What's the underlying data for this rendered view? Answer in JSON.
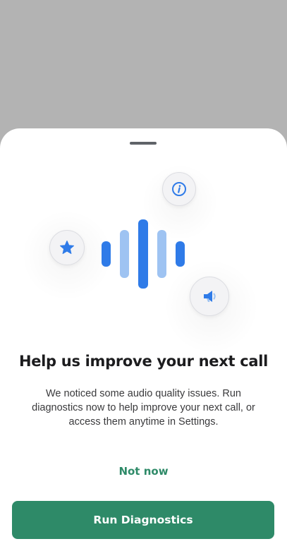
{
  "sheet": {
    "title": "Help us improve your next call",
    "body": "We noticed some audio quality issues. Run diagnostics now to help improve your next call, or access them anytime in Settings.",
    "secondary_label": "Not now",
    "primary_label": "Run Diagnostics"
  },
  "icons": {
    "top_badge": "info-icon",
    "left_badge": "star-icon",
    "right_badge": "megaphone-icon",
    "center": "audio-waveform-icon"
  },
  "colors": {
    "accent": "#2e8a68",
    "icon_blue": "#2f7be8",
    "icon_blue_light": "#9ec3f2",
    "backdrop": "#b3b3b3"
  }
}
